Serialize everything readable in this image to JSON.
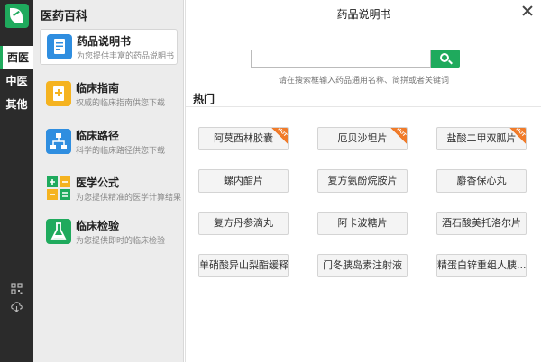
{
  "app": {
    "title": "医药百科"
  },
  "rail": {
    "tabs": [
      "西医",
      "中医",
      "其他"
    ],
    "active_index": 0
  },
  "categories": [
    {
      "name": "药品说明书",
      "desc": "为您提供丰富的药品说明书",
      "color": "#2f8ee0",
      "icon": "document-icon"
    },
    {
      "name": "临床指南",
      "desc": "权威的临床指南供您下载",
      "color": "#f5b320",
      "icon": "guide-icon"
    },
    {
      "name": "临床路径",
      "desc": "科学的临床路径供您下载",
      "color": "#2f8ee0",
      "icon": "pathway-icon"
    },
    {
      "name": "医学公式",
      "desc": "为您提供精准的医学计算结果",
      "color": "#1faa5d",
      "icon": "formula-icon"
    },
    {
      "name": "临床检验",
      "desc": "为您提供即时的临床检验",
      "color": "#1faa5d",
      "icon": "flask-icon"
    }
  ],
  "main": {
    "title": "药品说明书",
    "search_placeholder": "",
    "hint": "请在搜索框输入药品通用名称、简拼或者关键词",
    "hot_label": "热门",
    "hot_tag": "HOT",
    "drugs": [
      {
        "name": "阿莫西林胶囊",
        "hot": true
      },
      {
        "name": "厄贝沙坦片",
        "hot": true
      },
      {
        "name": "盐酸二甲双胍片",
        "hot": true
      },
      {
        "name": "螺内酯片",
        "hot": false
      },
      {
        "name": "复方氨酚烷胺片",
        "hot": false
      },
      {
        "name": "麝香保心丸",
        "hot": false
      },
      {
        "name": "复方丹参滴丸",
        "hot": false
      },
      {
        "name": "阿卡波糖片",
        "hot": false
      },
      {
        "name": "酒石酸美托洛尔片",
        "hot": false
      },
      {
        "name": "单硝酸异山梨酯缓释片",
        "hot": false
      },
      {
        "name": "门冬胰岛素注射液",
        "hot": false
      },
      {
        "name": "精蛋白锌重组人胰...",
        "hot": false
      }
    ]
  },
  "colors": {
    "accent": "#1faa5d",
    "rail_bg": "#2b2b2b",
    "hot": "#f07b2a"
  }
}
